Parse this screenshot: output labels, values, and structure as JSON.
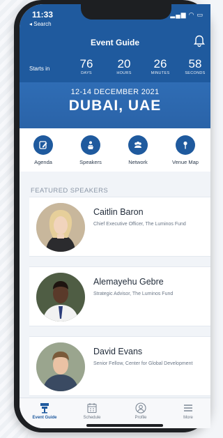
{
  "status": {
    "time": "11:33",
    "back": "◂ Search",
    "icons": "▂▄▆ ◠ ▭"
  },
  "header": {
    "title": "Event Guide"
  },
  "countdown": {
    "label": "Starts in",
    "units": [
      {
        "value": "76",
        "label": "DAYS"
      },
      {
        "value": "20",
        "label": "HOURS"
      },
      {
        "value": "26",
        "label": "MINUTES"
      },
      {
        "value": "58",
        "label": "SECONDS"
      }
    ]
  },
  "event": {
    "dates": "12-14 DECEMBER 2021",
    "city": "DUBAI, UAE"
  },
  "shortcuts": [
    {
      "label": "Agenda",
      "icon": "edit-icon"
    },
    {
      "label": "Speakers",
      "icon": "speaker-podium-icon"
    },
    {
      "label": "Network",
      "icon": "network-icon"
    },
    {
      "label": "Venue Map",
      "icon": "map-pin-icon"
    }
  ],
  "featured": {
    "section_label": "FEATURED SPEAKERS",
    "speakers": [
      {
        "name": "Caitlin Baron",
        "role": "Chief Executive Officer, The Luminos Fund"
      },
      {
        "name": "Alemayehu Gebre",
        "role": "Strategic Advisor, The Luminos Fund"
      },
      {
        "name": "David Evans",
        "role": "Senior Fellow, Center for Global Development"
      }
    ]
  },
  "tabs": [
    {
      "label": "Event Guide",
      "icon": "event-guide-icon",
      "active": true
    },
    {
      "label": "Schedule",
      "icon": "calendar-icon",
      "active": false
    },
    {
      "label": "Profile",
      "icon": "profile-icon",
      "active": false
    },
    {
      "label": "More",
      "icon": "menu-icon",
      "active": false
    }
  ],
  "colors": {
    "brand": "#1f5a9e",
    "hero": "#2f6db5"
  }
}
